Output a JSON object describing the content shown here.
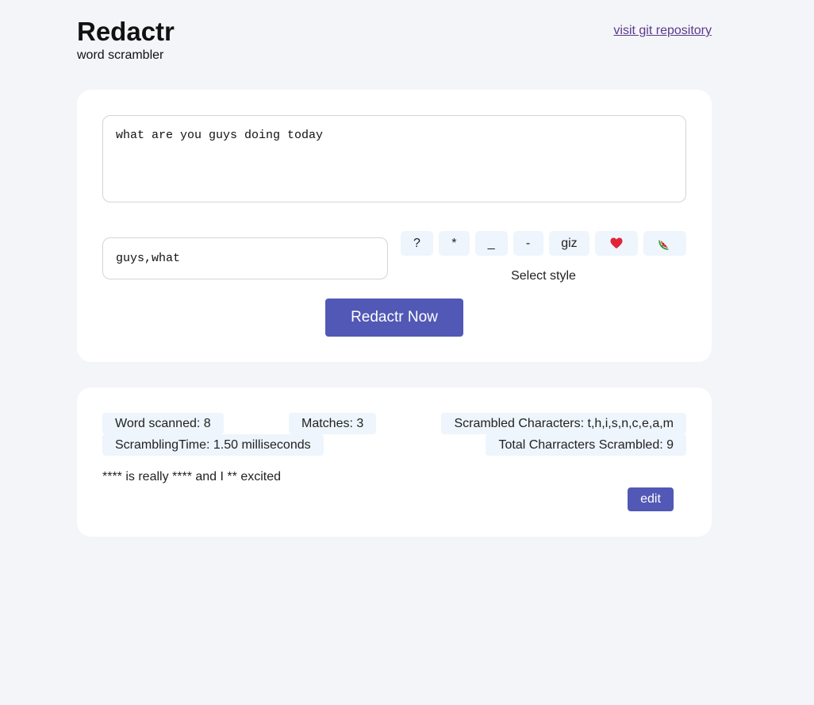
{
  "header": {
    "title": "Redactr",
    "subtitle": "word scrambler",
    "repo_link": "visit git repository"
  },
  "input_card": {
    "textarea_value": "what are you guys doing today",
    "words_value": "guys,what",
    "style_buttons": [
      {
        "label": "?",
        "icon": "question-mark"
      },
      {
        "label": "*",
        "icon": "asterisk"
      },
      {
        "label": "_",
        "icon": "underscore"
      },
      {
        "label": "-",
        "icon": "dash"
      },
      {
        "label": "giz",
        "icon": "giz-text"
      },
      {
        "label": "❤️",
        "icon": "heart-icon"
      },
      {
        "label": "🍉",
        "icon": "watermelon-icon"
      }
    ],
    "select_style_label": "Select style",
    "redact_button": "Redactr Now"
  },
  "results_card": {
    "words_scanned": "Word scanned: 8",
    "matches": "Matches: 3",
    "scrambled_characters": "Scrambled Characters: t,h,i,s,n,c,e,a,m",
    "scrambling_time": "ScramblingTime: 1.50 milliseconds",
    "total_scrambled": "Total Charracters Scrambled: 9",
    "result_text": "**** is really **** and I ** excited",
    "edit_button": "edit"
  },
  "colors": {
    "background": "#f4f5f9",
    "card": "#ffffff",
    "primary": "#5258b5",
    "chip": "#eef5fc",
    "link": "#5b3a8a"
  }
}
